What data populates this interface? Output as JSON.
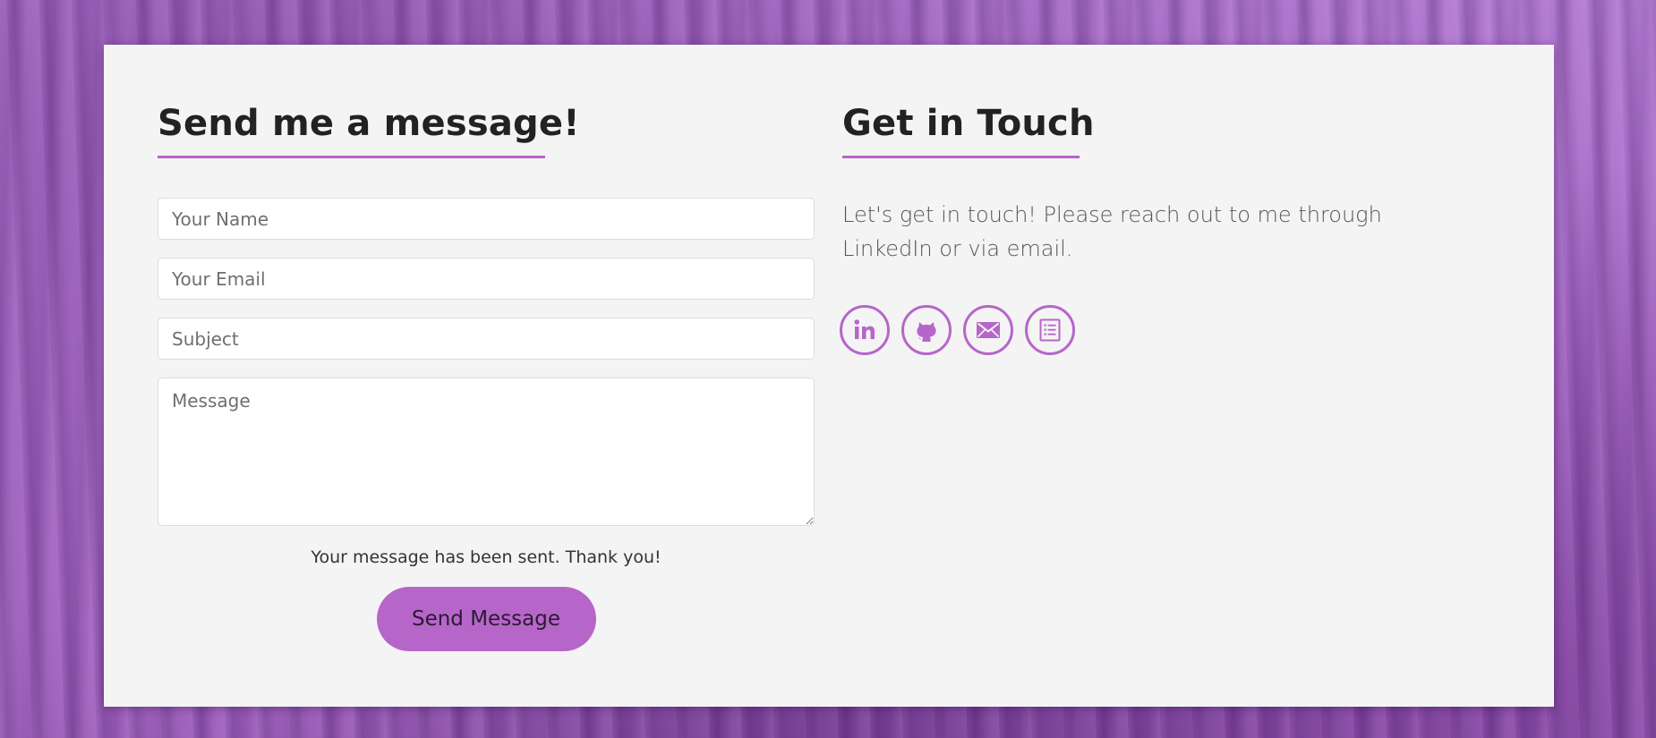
{
  "form_section": {
    "title": "Send me a message!",
    "name_placeholder": "Your Name",
    "email_placeholder": "Your Email",
    "subject_placeholder": "Subject",
    "message_placeholder": "Message",
    "status_message": "Your message has been sent. Thank you!",
    "send_label": "Send Message"
  },
  "contact_section": {
    "title": "Get in Touch",
    "intro": "Let's get in touch! Please reach out to me through LinkedIn or via email.",
    "socials": [
      {
        "icon": "linkedin-icon"
      },
      {
        "icon": "github-icon"
      },
      {
        "icon": "email-icon"
      },
      {
        "icon": "resume-icon"
      }
    ]
  },
  "colors": {
    "accent": "#b666c9",
    "card_background": "#f4f4f4",
    "heading_text": "#222222"
  }
}
